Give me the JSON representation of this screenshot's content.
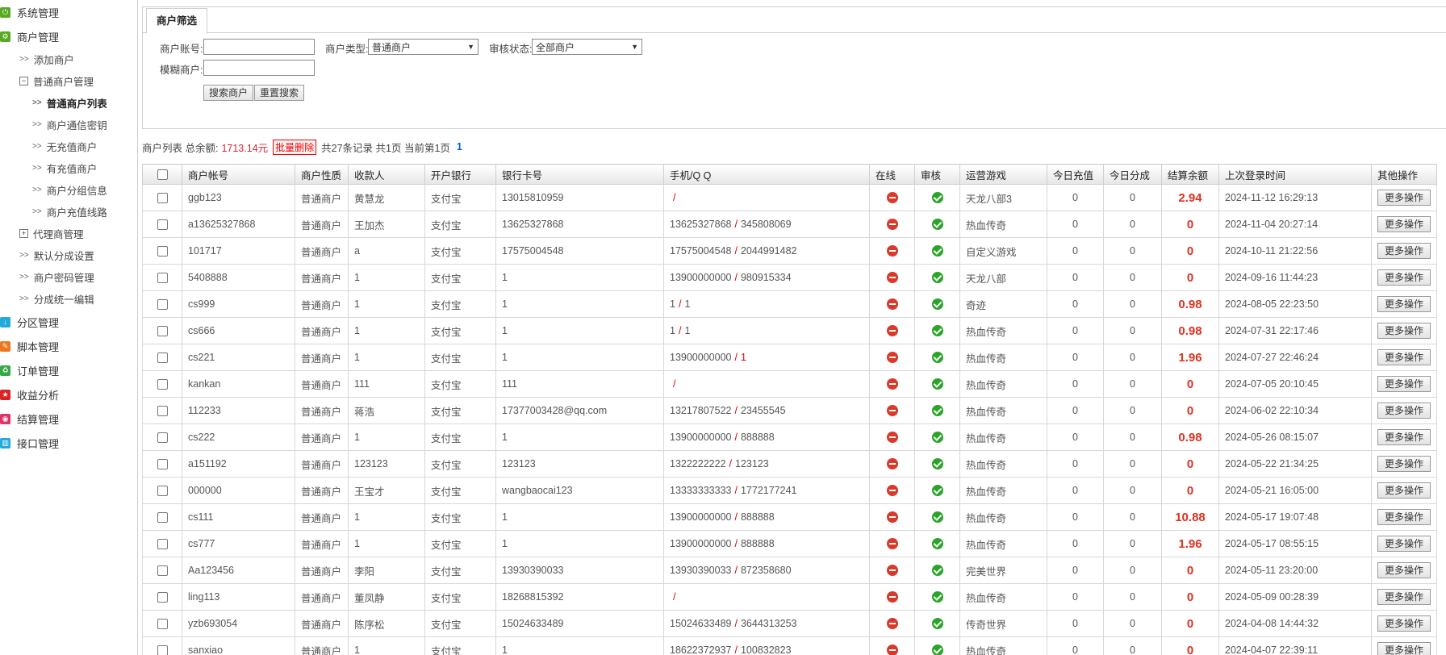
{
  "sidebar": {
    "items": [
      {
        "label": "系统管理",
        "color": "#55aa22",
        "glyph": "⏻",
        "icon": "power-icon",
        "kind": "top"
      },
      {
        "label": "商户管理",
        "color": "#55aa22",
        "glyph": "⚙",
        "icon": "gear-icon",
        "kind": "top"
      },
      {
        "label": "添加商户",
        "kind": "lvl1",
        "arrow": ">>"
      },
      {
        "label": "普通商户管理",
        "kind": "lvl1",
        "toggle": "−"
      },
      {
        "label": "普通商户列表",
        "kind": "lvl2",
        "arrow": ">>",
        "active": true
      },
      {
        "label": "商户通信密钥",
        "kind": "lvl2",
        "arrow": ">>"
      },
      {
        "label": "无充值商户",
        "kind": "lvl2",
        "arrow": ">>"
      },
      {
        "label": "有充值商户",
        "kind": "lvl2",
        "arrow": ">>"
      },
      {
        "label": "商户分组信息",
        "kind": "lvl2",
        "arrow": ">>"
      },
      {
        "label": "商户充值线路",
        "kind": "lvl2",
        "arrow": ">>"
      },
      {
        "label": "代理商管理",
        "kind": "lvl1",
        "toggle": "+"
      },
      {
        "label": "默认分成设置",
        "kind": "lvl1",
        "arrow": ">>"
      },
      {
        "label": "商户密码管理",
        "kind": "lvl1",
        "arrow": ">>"
      },
      {
        "label": "分成统一编辑",
        "kind": "lvl1",
        "arrow": ">>"
      },
      {
        "label": "分区管理",
        "color": "#22aadd",
        "glyph": "↓",
        "icon": "download-icon",
        "kind": "top"
      },
      {
        "label": "脚本管理",
        "color": "#ee7722",
        "glyph": "✎",
        "icon": "pencil-icon",
        "kind": "top"
      },
      {
        "label": "订单管理",
        "color": "#33aa44",
        "glyph": "♻",
        "icon": "recycle-icon",
        "kind": "top"
      },
      {
        "label": "收益分析",
        "color": "#dd2222",
        "glyph": "★",
        "icon": "star-icon",
        "kind": "top"
      },
      {
        "label": "结算管理",
        "color": "#dd3366",
        "glyph": "◉",
        "icon": "target-icon",
        "kind": "top"
      },
      {
        "label": "接口管理",
        "color": "#22aadd",
        "glyph": "▥",
        "icon": "chart-icon",
        "kind": "top"
      }
    ]
  },
  "filter": {
    "tab_label": "商户筛选",
    "account_label": "商户账号:",
    "account_value": "",
    "type_label": "商户类型:",
    "type_value": "普通商户",
    "audit_label": "审核状态:",
    "audit_value": "全部商户",
    "fuzzy_label": "模糊商户:",
    "fuzzy_value": "",
    "search_button": "搜索商户",
    "reset_button": "重置搜索"
  },
  "summary": {
    "prefix": "商户列表 总余额:",
    "total_amount": "1713.14元",
    "batch_delete": "批量删除",
    "records": "共27条记录 共1页 当前第1页",
    "page": "1"
  },
  "table": {
    "headers": [
      "商户帐号",
      "商户性质",
      "收款人",
      "开户银行",
      "银行卡号",
      "手机/Q Q",
      "在线",
      "审核",
      "运营游戏",
      "今日充值",
      "今日分成",
      "结算余额",
      "上次登录时间",
      "其他操作"
    ],
    "more_label": "更多操作",
    "status_colors": {
      "offline": "#d83a2a",
      "approved": "#2aa52a"
    },
    "rows": [
      {
        "account": "ggb123",
        "type": "普通商户",
        "payee": "黄慧龙",
        "bank": "支付宝",
        "card": "13015810959",
        "phone": "",
        "qq": "",
        "game": "天龙八部3",
        "recharge": "0",
        "share": "0",
        "balance": "2.94",
        "last_login": "2024-11-12 16:29:13"
      },
      {
        "account": "a13625327868",
        "type": "普通商户",
        "payee": "王加杰",
        "bank": "支付宝",
        "card": "13625327868",
        "phone": "13625327868",
        "qq": "345808069",
        "game": "热血传奇",
        "recharge": "0",
        "share": "0",
        "balance": "0",
        "last_login": "2024-11-04 20:27:14"
      },
      {
        "account": "101717",
        "type": "普通商户",
        "payee": "a",
        "bank": "支付宝",
        "card": "17575004548",
        "phone": "17575004548",
        "qq": "2044991482",
        "game": "自定义游戏",
        "recharge": "0",
        "share": "0",
        "balance": "0",
        "last_login": "2024-10-11 21:22:56"
      },
      {
        "account": "5408888",
        "type": "普通商户",
        "payee": "1",
        "bank": "支付宝",
        "card": "1",
        "phone": "13900000000",
        "qq": "980915334",
        "game": "天龙八部",
        "recharge": "0",
        "share": "0",
        "balance": "0",
        "last_login": "2024-09-16 11:44:23"
      },
      {
        "account": "cs999",
        "type": "普通商户",
        "payee": "1",
        "bank": "支付宝",
        "card": "1",
        "phone": "1",
        "qq": "1",
        "game": "奇迹",
        "recharge": "0",
        "share": "0",
        "balance": "0.98",
        "last_login": "2024-08-05 22:23:50"
      },
      {
        "account": "cs666",
        "type": "普通商户",
        "payee": "1",
        "bank": "支付宝",
        "card": "1",
        "phone": "1",
        "qq": "1",
        "game": "热血传奇",
        "recharge": "0",
        "share": "0",
        "balance": "0.98",
        "last_login": "2024-07-31 22:17:46"
      },
      {
        "account": "cs221",
        "type": "普通商户",
        "payee": "1",
        "bank": "支付宝",
        "card": "1",
        "phone": "13900000000",
        "qq": "1",
        "qq_red": true,
        "game": "热血传奇",
        "recharge": "0",
        "share": "0",
        "balance": "1.96",
        "last_login": "2024-07-27 22:46:24"
      },
      {
        "account": "kankan",
        "type": "普通商户",
        "payee": "111",
        "bank": "支付宝",
        "card": "111",
        "phone": "",
        "qq": "",
        "game": "热血传奇",
        "recharge": "0",
        "share": "0",
        "balance": "0",
        "last_login": "2024-07-05 20:10:45"
      },
      {
        "account": "112233",
        "type": "普通商户",
        "payee": "蒋浩",
        "bank": "支付宝",
        "card": "17377003428@qq.com",
        "phone": "13217807522",
        "qq": "23455545",
        "game": "热血传奇",
        "recharge": "0",
        "share": "0",
        "balance": "0",
        "last_login": "2024-06-02 22:10:34"
      },
      {
        "account": "cs222",
        "type": "普通商户",
        "payee": "1",
        "bank": "支付宝",
        "card": "1",
        "phone": "13900000000",
        "qq": "888888",
        "game": "热血传奇",
        "recharge": "0",
        "share": "0",
        "balance": "0.98",
        "last_login": "2024-05-26 08:15:07"
      },
      {
        "account": "a151192",
        "type": "普通商户",
        "payee": "123123",
        "bank": "支付宝",
        "card": "123123",
        "phone": "1322222222",
        "qq": "123123",
        "game": "热血传奇",
        "recharge": "0",
        "share": "0",
        "balance": "0",
        "last_login": "2024-05-22 21:34:25"
      },
      {
        "account": "000000",
        "type": "普通商户",
        "payee": "王宝才",
        "bank": "支付宝",
        "card": "wangbaocai123",
        "phone": "13333333333",
        "qq": "1772177241",
        "game": "热血传奇",
        "recharge": "0",
        "share": "0",
        "balance": "0",
        "last_login": "2024-05-21 16:05:00"
      },
      {
        "account": "cs111",
        "type": "普通商户",
        "payee": "1",
        "bank": "支付宝",
        "card": "1",
        "phone": "13900000000",
        "qq": "888888",
        "game": "热血传奇",
        "recharge": "0",
        "share": "0",
        "balance": "10.88",
        "last_login": "2024-05-17 19:07:48"
      },
      {
        "account": "cs777",
        "type": "普通商户",
        "payee": "1",
        "bank": "支付宝",
        "card": "1",
        "phone": "13900000000",
        "qq": "888888",
        "game": "热血传奇",
        "recharge": "0",
        "share": "0",
        "balance": "1.96",
        "last_login": "2024-05-17 08:55:15"
      },
      {
        "account": "Aa123456",
        "type": "普通商户",
        "payee": "李阳",
        "bank": "支付宝",
        "card": "13930390033",
        "phone": "13930390033",
        "qq": "872358680",
        "game": "完美世界",
        "recharge": "0",
        "share": "0",
        "balance": "0",
        "last_login": "2024-05-11 23:20:00"
      },
      {
        "account": "ling113",
        "type": "普通商户",
        "payee": "董凤静",
        "bank": "支付宝",
        "card": "18268815392",
        "phone": "",
        "qq": "",
        "game": "热血传奇",
        "recharge": "0",
        "share": "0",
        "balance": "0",
        "last_login": "2024-05-09 00:28:39"
      },
      {
        "account": "yzb693054",
        "type": "普通商户",
        "payee": "陈序松",
        "bank": "支付宝",
        "card": "15024633489",
        "phone": "15024633489",
        "qq": "3644313253",
        "game": "传奇世界",
        "recharge": "0",
        "share": "0",
        "balance": "0",
        "last_login": "2024-04-08 14:44:32"
      },
      {
        "account": "sanxiao",
        "type": "普通商户",
        "payee": "1",
        "bank": "支付宝",
        "card": "1",
        "phone": "18622372937",
        "qq": "100832823",
        "game": "热血传奇",
        "recharge": "0",
        "share": "0",
        "balance": "0",
        "last_login": "2024-04-07 22:39:11"
      }
    ]
  }
}
